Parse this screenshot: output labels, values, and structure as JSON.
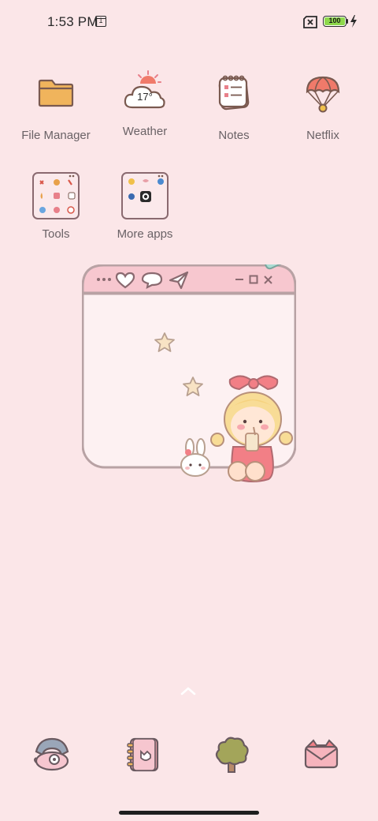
{
  "status_bar": {
    "time": "1:53 PM",
    "calendar_day": "1",
    "battery_level": "100",
    "icons": [
      "calendar-icon",
      "no-sim-icon",
      "battery-icon",
      "charging-bolt-icon"
    ]
  },
  "home": {
    "apps": [
      {
        "name": "File Manager",
        "icon": "folder-icon"
      },
      {
        "name": "Weather",
        "icon": "weather-cloud-icon",
        "temperature": "17°"
      },
      {
        "name": "Notes",
        "icon": "notes-icon"
      },
      {
        "name": "Netflix",
        "icon": "parachute-icon"
      }
    ],
    "folders": [
      {
        "name": "Tools"
      },
      {
        "name": "More apps"
      }
    ]
  },
  "widget": {
    "icons": [
      "heart-icon",
      "chat-icon",
      "send-icon",
      "minimize-icon",
      "maximize-icon",
      "close-icon",
      "star-icon",
      "girl-illustration",
      "bunny-illustration"
    ]
  },
  "dock": {
    "apps": [
      {
        "icon": "phone-icon"
      },
      {
        "icon": "contacts-book-icon"
      },
      {
        "icon": "tree-icon"
      },
      {
        "icon": "envelope-icon"
      }
    ]
  },
  "colors": {
    "background": "#fbe6e8",
    "accent_pink": "#f2a8b4",
    "outline": "#8a6a70",
    "battery_green": "#8ed84b"
  }
}
